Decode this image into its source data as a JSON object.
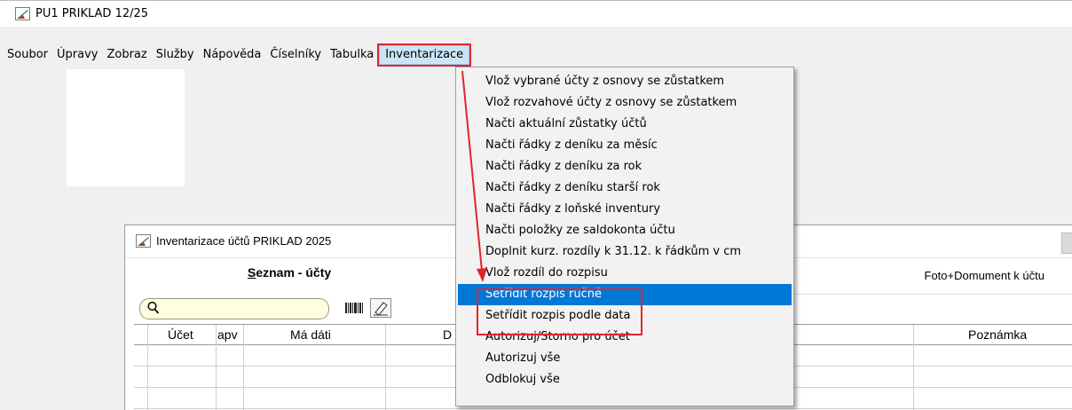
{
  "window": {
    "title": "PU1 PRIKLAD 12/25"
  },
  "menu_bar": {
    "items": [
      "Soubor",
      "Úpravy",
      "Zobraz",
      "Služby",
      "Nápověda",
      "Číselníky",
      "Tabulka",
      "Inventarizace"
    ],
    "active_index": 7
  },
  "dropdown": {
    "items": [
      "Vlož vybrané účty z osnovy se zůstatkem",
      "Vlož rozvahové účty z osnovy se zůstatkem",
      "Načti aktuální zůstatky účtů",
      "Načti řádky z deníku za měsíc",
      "Načti řádky z deníku za rok",
      "Načti řádky z deníku starší rok",
      "Načti řádky z loňské inventury",
      "Načti položky ze saldokonta účtu",
      "Doplnit kurz. rozdíly k 31.12. k řádkům v cm",
      "Vlož rozdíl do rozpisu",
      "Setřídit rozpis ručně",
      "Setřídit rozpis podle data",
      "Autorizuj/Storno pro účet",
      "Autorizuj vše",
      "Odblokuj vše"
    ],
    "highlighted_index": 10
  },
  "child_window": {
    "title": "Inventarizace účtů PRIKLAD 2025",
    "panel_title_underlined": "S",
    "panel_title_rest": "eznam - účty",
    "right_panel_title": "Foto+Domument k účtu",
    "grid_headers": {
      "account": "Účet",
      "apv": "apv",
      "debit": "Má dáti",
      "credit": "D",
      "note": "Poznámka"
    }
  },
  "colors": {
    "highlight": "#0078d7",
    "annotation_red": "#e0262b",
    "menu_active_bg": "#cce4f7",
    "search_bg": "#ffffe0"
  }
}
